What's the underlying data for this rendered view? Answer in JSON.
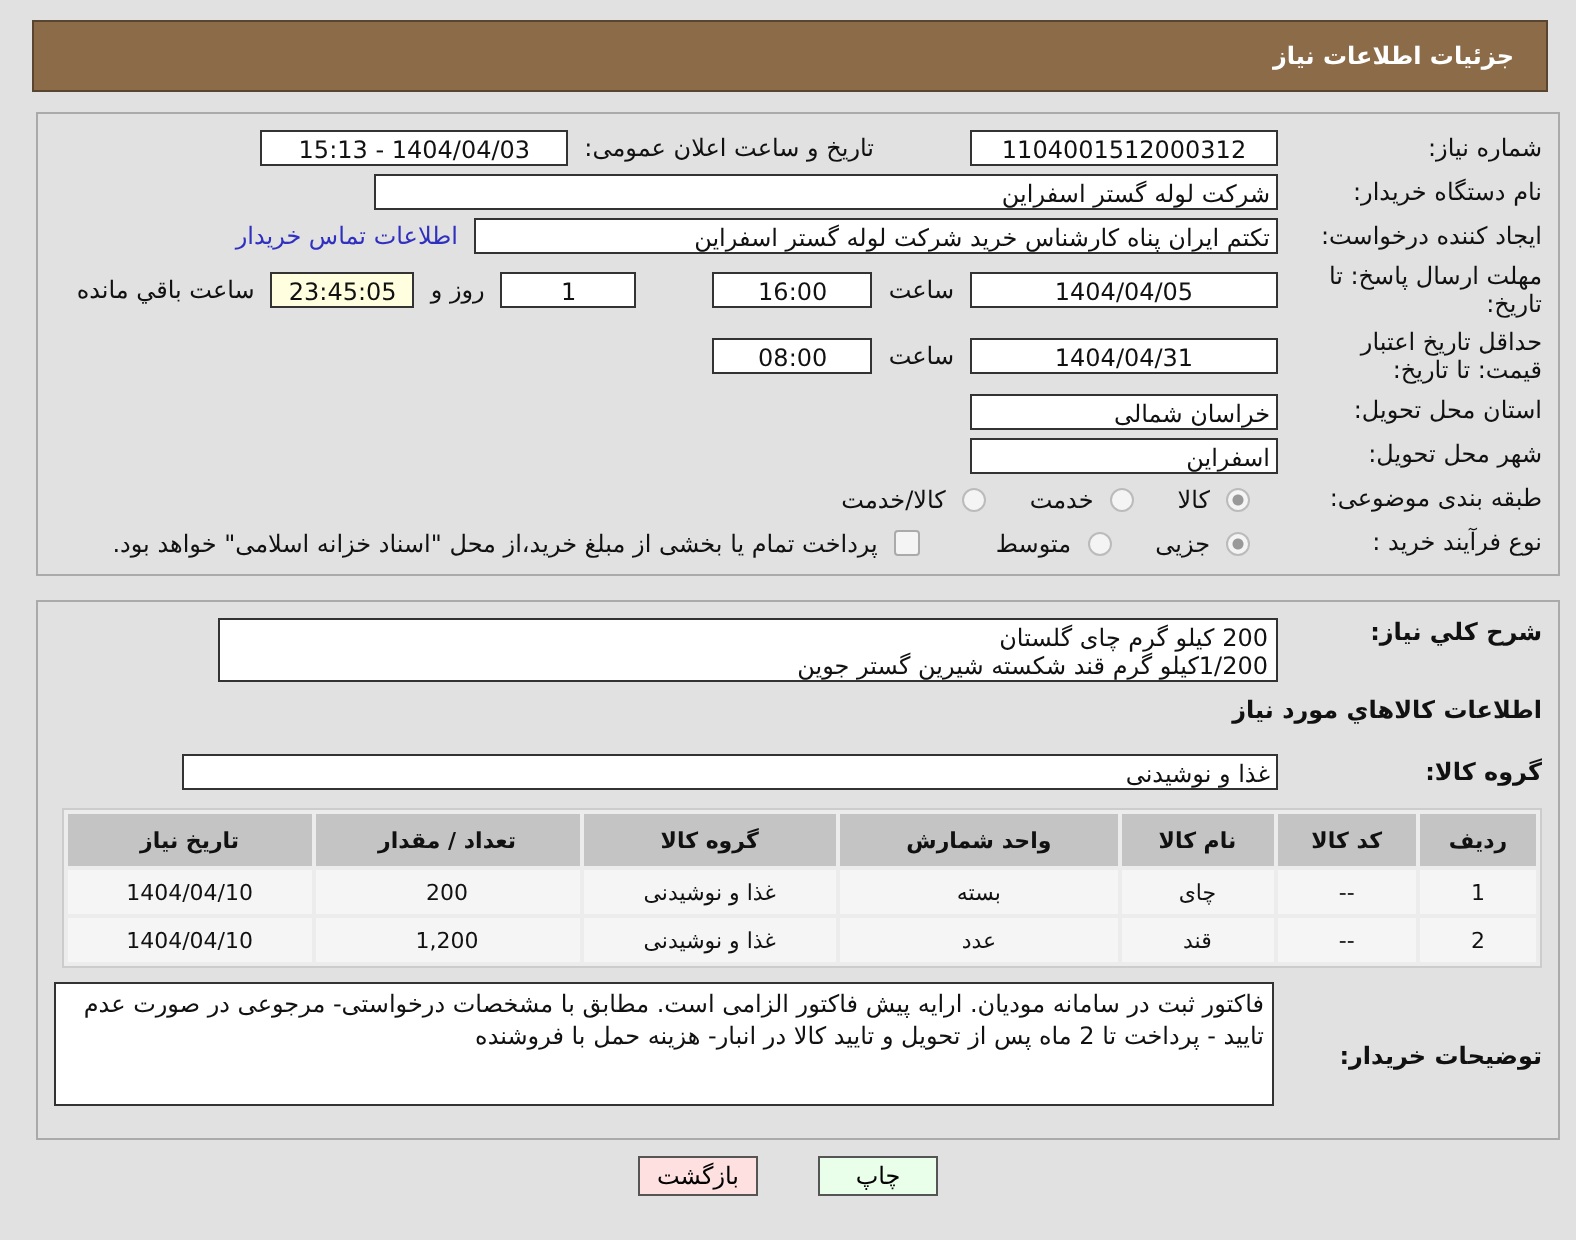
{
  "header": {
    "title": "جزئیات اطلاعات نیاز"
  },
  "need_number": {
    "label": "شماره نیاز:",
    "value": "1104001512000312"
  },
  "announce": {
    "label": "تاریخ و ساعت اعلان عمومی:",
    "value": "1404/04/03 - 15:13"
  },
  "buyer_org": {
    "label": "نام دستگاه خریدار:",
    "value": "شرکت لوله گستر اسفراین"
  },
  "creator": {
    "label": "ایجاد کننده درخواست:",
    "value": "تکتم ایران پناه کارشناس خرید شرکت لوله گستر اسفراین",
    "link": "اطلاعات تماس خریدار"
  },
  "deadline": {
    "label": "مهلت ارسال پاسخ: تا تاریخ:",
    "date": "1404/04/05",
    "time_label": "ساعت",
    "time": "16:00",
    "days": "1",
    "days_label": "روز و",
    "remaining": "23:45:05",
    "remaining_label": "ساعت باقي مانده"
  },
  "validity": {
    "label": "حداقل تاریخ اعتبار قیمت: تا تاریخ:",
    "date": "1404/04/31",
    "time_label": "ساعت",
    "time": "08:00"
  },
  "province": {
    "label": "استان محل تحویل:",
    "value": "خراسان شمالی"
  },
  "city": {
    "label": "شهر محل تحویل:",
    "value": "اسفراین"
  },
  "category": {
    "label": "طبقه بندی موضوعی:",
    "options": [
      {
        "label": "کالا",
        "selected": true
      },
      {
        "label": "خدمت",
        "selected": false
      },
      {
        "label": "کالا/خدمت",
        "selected": false
      }
    ]
  },
  "process": {
    "label": "نوع فرآیند خرید :",
    "options": [
      {
        "label": "جزیی",
        "selected": true
      },
      {
        "label": "متوسط",
        "selected": false
      }
    ],
    "treasury": {
      "label": "پرداخت تمام یا بخشی از مبلغ خرید،از محل \"اسناد خزانه اسلامی\" خواهد بود.",
      "checked": false
    }
  },
  "description": {
    "label": "شرح كلي نياز:",
    "lines": [
      "200  کیلو گرم چای گلستان",
      "1/200کیلو گرم قند شکسته شیرین گستر جوین"
    ]
  },
  "goods_title": "اطلاعات كالاهاي مورد نياز",
  "goods_group": {
    "label": "گروه کالا:",
    "value": "غذا و نوشیدنی"
  },
  "table": {
    "columns": [
      "ردیف",
      "کد کالا",
      "نام کالا",
      "واحد شمارش",
      "گروه کالا",
      "تعداد / مقدار",
      "تاریخ نیاز"
    ],
    "rows": [
      [
        "1",
        "--",
        "چای",
        "بسته",
        "غذا و نوشیدنی",
        "200",
        "1404/04/10"
      ],
      [
        "2",
        "--",
        "قند",
        "عدد",
        "غذا و نوشیدنی",
        "1,200",
        "1404/04/10"
      ]
    ]
  },
  "buyer_notes": {
    "label": "توضیحات خریدار:",
    "value": "فاکتور ثبت در سامانه مودیان. ارایه پیش فاکتور الزامی است. مطابق با مشخصات درخواستی- مرجوعی در صورت عدم تایید - پرداخت تا 2 ماه پس از تحویل و تایید کالا در انبار- هزینه حمل با فروشنده"
  },
  "buttons": [
    {
      "label": "چاپ",
      "kind": "print"
    },
    {
      "label": "بازگشت",
      "kind": "back"
    }
  ]
}
